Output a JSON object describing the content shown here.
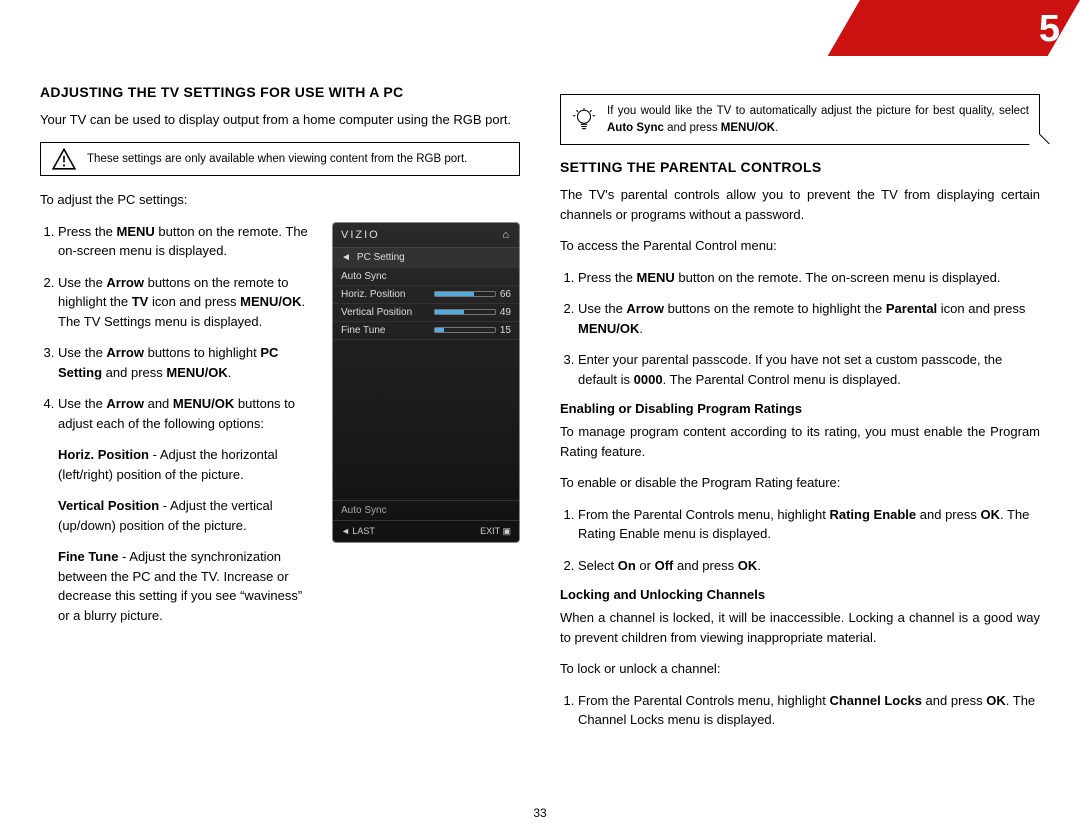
{
  "chapter_number": "5",
  "page_number": "33",
  "left": {
    "h1": "ADJUSTING THE TV SETTINGS FOR USE WITH A PC",
    "intro": "Your TV can be used to display output from a home computer using the RGB port.",
    "callout": "These settings are only available when viewing content from the RGB port.",
    "lead": "To adjust the PC settings:",
    "steps": {
      "s1a": "Press the ",
      "s1b": "MENU",
      "s1c": " button on the remote. The on-screen menu is displayed.",
      "s2a": "Use the ",
      "s2b": "Arrow",
      "s2c": " buttons on the remote to highlight the ",
      "s2d": "TV",
      "s2e": " icon and press ",
      "s2f": "MENU/OK",
      "s2g": ". The TV Settings menu is displayed.",
      "s3a": "Use the ",
      "s3b": "Arrow",
      "s3c": " buttons to highlight ",
      "s3d": "PC Setting",
      "s3e": " and press ",
      "s3f": "MENU/OK",
      "s3g": ".",
      "s4a": "Use the ",
      "s4b": "Arrow",
      "s4c": " and ",
      "s4d": "MENU/OK",
      "s4e": " buttons to adjust each of the following options:",
      "hp_t": "Horiz. Position",
      "hp_d": " - Adjust the horizontal (left/right) position of the picture.",
      "vp_t": "Vertical Position",
      "vp_d": " - Adjust the vertical (up/down) position of the picture.",
      "ft_t": "Fine Tune",
      "ft_d": " - Adjust the synchro­nization between the PC and the TV. Increase or decrease this setting if you see “waviness” or a blurry picture."
    },
    "tv": {
      "brand": "VIZIO",
      "breadcrumb": "PC Setting",
      "rows": [
        {
          "label": "Auto Sync",
          "val": "",
          "pct": 0
        },
        {
          "label": "Horiz. Position",
          "val": "66",
          "pct": 66
        },
        {
          "label": "Vertical Position",
          "val": "49",
          "pct": 49
        },
        {
          "label": "Fine Tune",
          "val": "15",
          "pct": 15
        }
      ],
      "status": "Auto Sync",
      "last": "◄ LAST",
      "exit": "EXIT ▣"
    }
  },
  "right": {
    "tip_a": "If you would like the TV to automatically adjust the picture for best quality, select ",
    "tip_b": "Auto Sync",
    "tip_c": " and press ",
    "tip_d": "MENU/OK",
    "tip_e": ".",
    "h1": "SETTING THE PARENTAL CONTROLS",
    "intro": "The TV's parental controls allow you to prevent the TV from displaying certain channels or programs without a password.",
    "lead": "To access the Parental Control menu:",
    "s1a": "Press the ",
    "s1b": "MENU",
    "s1c": " button on the remote. The on-screen menu is displayed.",
    "s2a": "Use the ",
    "s2b": "Arrow",
    "s2c": " buttons on the remote to highlight the ",
    "s2d": "Parental",
    "s2e": " icon and press ",
    "s2f": "MENU/OK",
    "s2g": ".",
    "s3a": "Enter your parental passcode. If you have not set a custom passcode, the default is ",
    "s3b": "0000",
    "s3c": ". The Parental Control menu is displayed.",
    "h2a": "Enabling or Disabling Program Ratings",
    "p2a": "To manage program content according to its rating, you must enable the Program Rating feature.",
    "p2b": "To enable or disable the Program Rating feature:",
    "r1a": "From the Parental Controls menu, highlight ",
    "r1b": "Rating Enable",
    "r1c": " and press ",
    "r1d": "OK",
    "r1e": ". The Rating Enable menu is displayed.",
    "r2a": "Select ",
    "r2b": "On",
    "r2c": " or ",
    "r2d": "Off",
    "r2e": " and press ",
    "r2f": "OK",
    "r2g": ".",
    "h2b": "Locking and Unlocking Channels",
    "p3a": "When a channel is locked, it will be inaccessible. Locking a channel is a good way to prevent children from viewing inappropriate material.",
    "p3b": "To lock or unlock a channel:",
    "c1a": "From the Parental Controls menu, highlight ",
    "c1b": "Channel Locks",
    "c1c": " and press ",
    "c1d": "OK",
    "c1e": ". The Channel Locks menu is displayed."
  }
}
